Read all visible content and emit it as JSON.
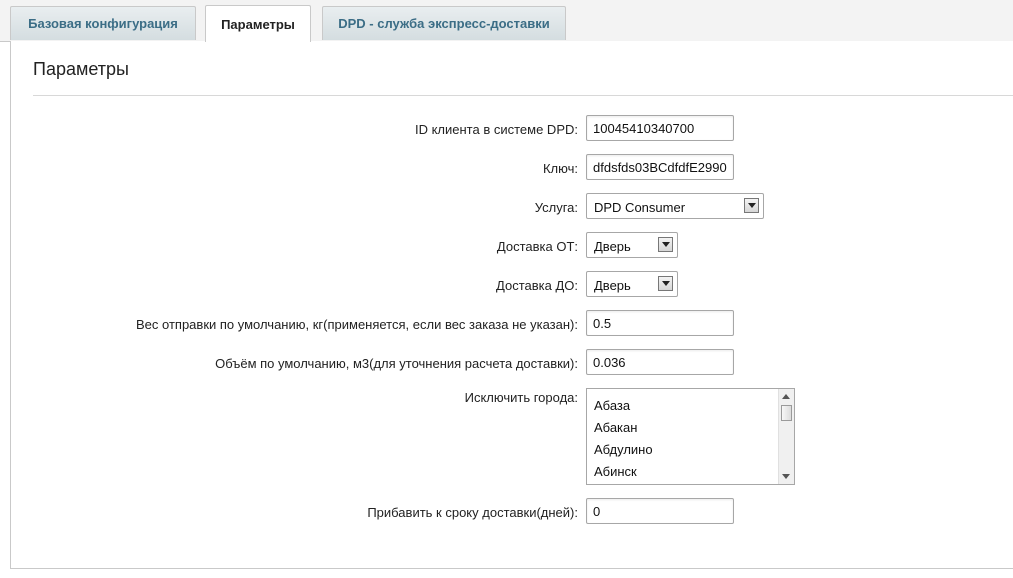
{
  "tabs": [
    {
      "label": "Базовая конфигурация",
      "active": false
    },
    {
      "label": "Параметры",
      "active": true
    },
    {
      "label": "DPD - служба экспресс-доставки",
      "active": false
    }
  ],
  "panel": {
    "title": "Параметры"
  },
  "form": {
    "client_id": {
      "label": "ID клиента в системе DPD:",
      "value": "10045410340700"
    },
    "key": {
      "label": "Ключ:",
      "value": "dfdsfds03BCdfdfE2990"
    },
    "service": {
      "label": "Услуга:",
      "selected": "DPD Consumer"
    },
    "delivery_from": {
      "label": "Доставка ОТ:",
      "selected": "Дверь"
    },
    "delivery_to": {
      "label": "Доставка ДО:",
      "selected": "Дверь"
    },
    "default_weight": {
      "label": "Вес отправки по умолчанию, кг(применяется, если вес заказа не указан):",
      "value": "0.5"
    },
    "default_volume": {
      "label": "Объём по умолчанию, м3(для уточнения расчета доставки):",
      "value": "0.036"
    },
    "exclude_cities": {
      "label": "Исключить города:",
      "options": [
        "Абаза",
        "Абакан",
        "Абдулино",
        "Абинск"
      ]
    },
    "add_days": {
      "label": "Прибавить к сроку доставки(дней):",
      "value": "0"
    }
  },
  "colors": {
    "tab_text": "#3b6d86",
    "border": "#c9c9c9"
  }
}
